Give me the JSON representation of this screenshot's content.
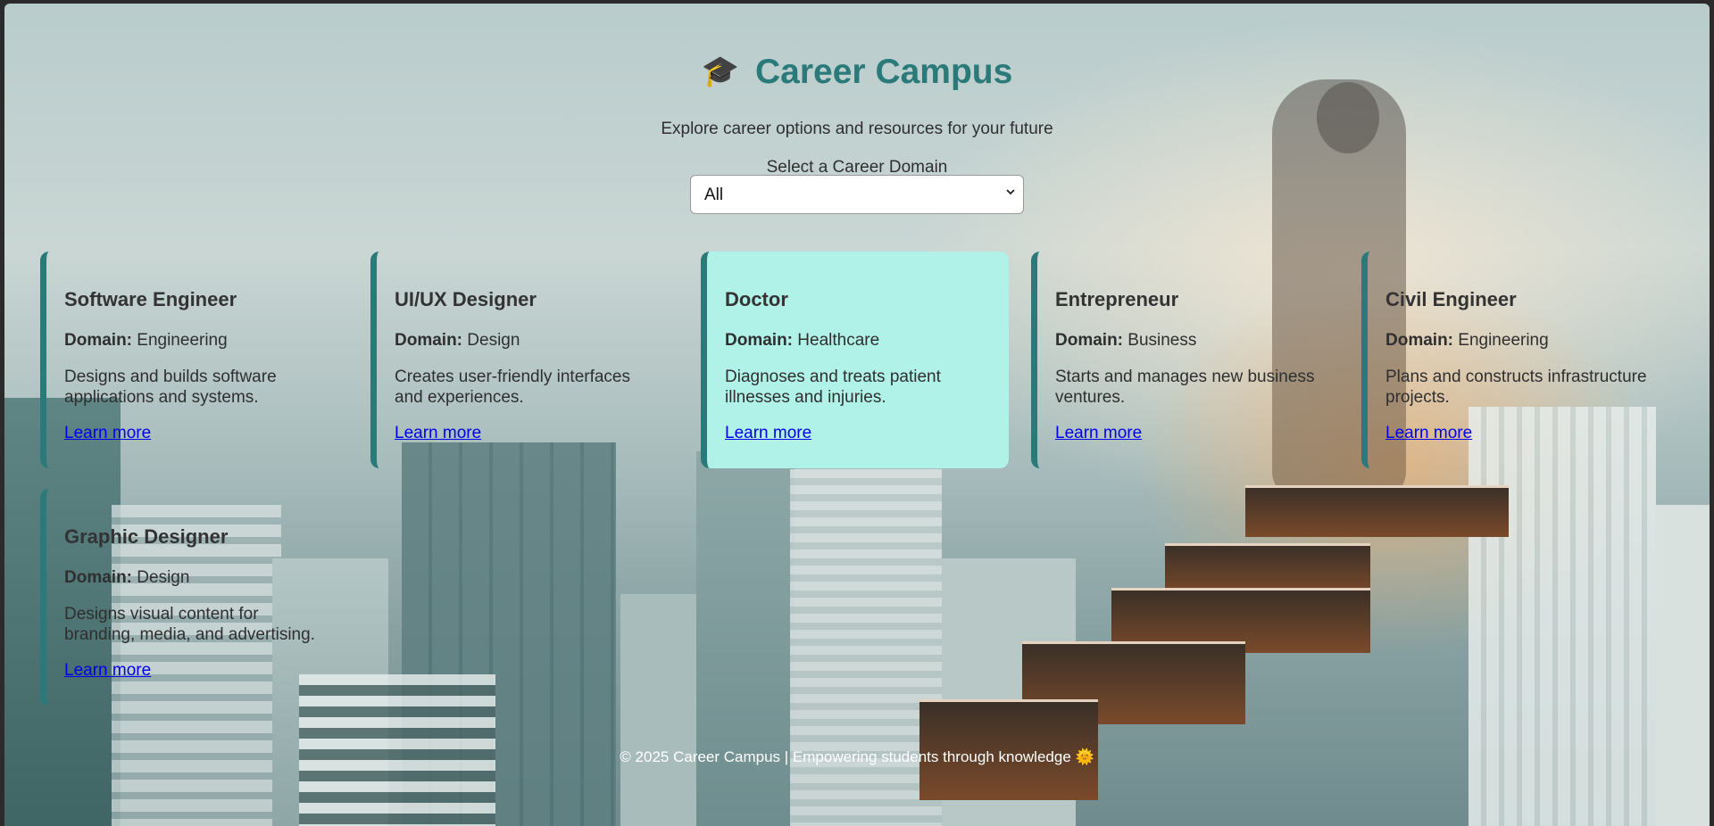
{
  "header": {
    "icon": "graduation-cap-icon",
    "title": "Career Campus",
    "subtitle": "Explore career options and resources for your future"
  },
  "filter": {
    "label": "Select a Career Domain",
    "selected": "All"
  },
  "cards": [
    {
      "title": "Software Engineer",
      "domain_label": "Domain:",
      "domain": "Engineering",
      "description": "Designs and builds software applications and systems.",
      "link": "Learn more"
    },
    {
      "title": "UI/UX Designer",
      "domain_label": "Domain:",
      "domain": "Design",
      "description": "Creates user-friendly interfaces and experiences.",
      "link": "Learn more"
    },
    {
      "title": "Doctor",
      "domain_label": "Domain:",
      "domain": "Healthcare",
      "description": "Diagnoses and treats patient illnesses and injuries.",
      "link": "Learn more"
    },
    {
      "title": "Entrepreneur",
      "domain_label": "Domain:",
      "domain": "Business",
      "description": "Starts and manages new business ventures.",
      "link": "Learn more"
    },
    {
      "title": "Civil Engineer",
      "domain_label": "Domain:",
      "domain": "Engineering",
      "description": "Plans and constructs infrastructure projects.",
      "link": "Learn more"
    },
    {
      "title": "Graphic Designer",
      "domain_label": "Domain:",
      "domain": "Design",
      "description": "Designs visual content for branding, media, and advertising.",
      "link": "Learn more"
    }
  ],
  "footer": {
    "text": "© 2025 Career Campus | Empowering students through knowledge",
    "icon": "sun-icon"
  },
  "colors": {
    "accent": "#2a7a7a",
    "active_card": "#b0f2e8",
    "link": "#0000ee"
  }
}
